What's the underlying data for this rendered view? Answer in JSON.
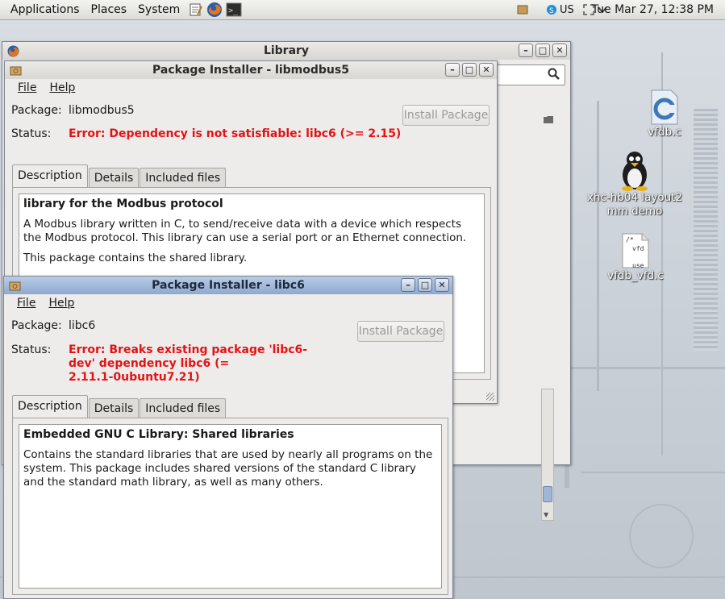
{
  "panel": {
    "menus": [
      "Applications",
      "Places",
      "System"
    ],
    "clock": "Tue Mar 27, 12:38 PM",
    "tray_text": "US"
  },
  "desktop_icons": [
    {
      "label": "vfdb.c"
    },
    {
      "label_line1": "xhc-hb04 layout2",
      "label_line2": "mm demo"
    },
    {
      "label": "vfdb_vfd.c",
      "thumb_lines": [
        "/*",
        "vfd",
        "use"
      ]
    }
  ],
  "library_window": {
    "title": "Library"
  },
  "installer1": {
    "title": "Package Installer - libmodbus5",
    "menu": [
      "File",
      "Help"
    ],
    "package_label": "Package:",
    "package_value": "libmodbus5",
    "status_label": "Status:",
    "status_value": "Error: Dependency is not satisfiable: libc6 (>= 2.15)",
    "install_button": "Install Package",
    "tabs": [
      "Description",
      "Details",
      "Included files"
    ],
    "desc_title": "library for the Modbus protocol",
    "desc_p1": "A Modbus library written in C, to send/receive data with a device which respects the Modbus protocol. This library can use a serial port or an Ethernet connection.",
    "desc_p2": "This package contains the shared library."
  },
  "installer2": {
    "title": "Package Installer - libc6",
    "menu": [
      "File",
      "Help"
    ],
    "package_label": "Package:",
    "package_value": "libc6",
    "status_label": "Status:",
    "status_line1": "Error: Breaks existing package 'libc6-",
    "status_line2": "dev' dependency libc6 (=",
    "status_line3": "2.11.1-0ubuntu7.21)",
    "install_button": "Install Package",
    "tabs": [
      "Description",
      "Details",
      "Included files"
    ],
    "desc_title": "Embedded GNU C Library: Shared libraries",
    "desc_p1": "Contains the standard libraries that are used by nearly all programs on the system. This package includes shared versions of the standard C library and the standard math library, as well as many others."
  },
  "colors": {
    "error": "#e31313",
    "active_title": "#8fa9d0"
  }
}
